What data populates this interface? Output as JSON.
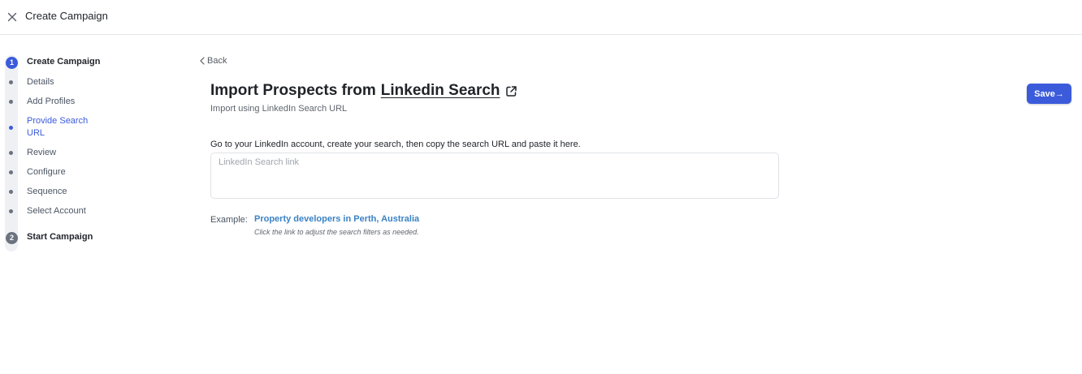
{
  "header": {
    "title": "Create Campaign"
  },
  "stepper": {
    "steps": [
      {
        "number": "1",
        "label": "Create Campaign"
      },
      {
        "number": "2",
        "label": "Start Campaign"
      }
    ],
    "substeps": [
      "Details",
      "Add Profiles",
      "Provide Search URL",
      "Review",
      "Configure",
      "Sequence",
      "Select Account"
    ],
    "active_substep": "Provide Search URL"
  },
  "back": {
    "label": "Back"
  },
  "main": {
    "title_prefix": "Import Prospects from",
    "title_link": "Linkedin Search",
    "subtitle": "Import using LinkedIn Search URL",
    "instructions": "Go to your LinkedIn account, create your search, then copy the search URL and paste it here.",
    "input_placeholder": "LinkedIn Search link",
    "input_value": "",
    "example_label": "Example:",
    "example_link": "Property developers in Perth, Australia",
    "example_hint": "Click the link to adjust the search filters as needed."
  },
  "toolbar": {
    "save_label": "Save→"
  },
  "colors": {
    "accent": "#3b5bdb",
    "link": "#3b82c4",
    "muted_step": "#6b7280"
  },
  "icons": {
    "close": "close-icon",
    "back": "chevron-left-icon",
    "external": "external-link-icon"
  }
}
